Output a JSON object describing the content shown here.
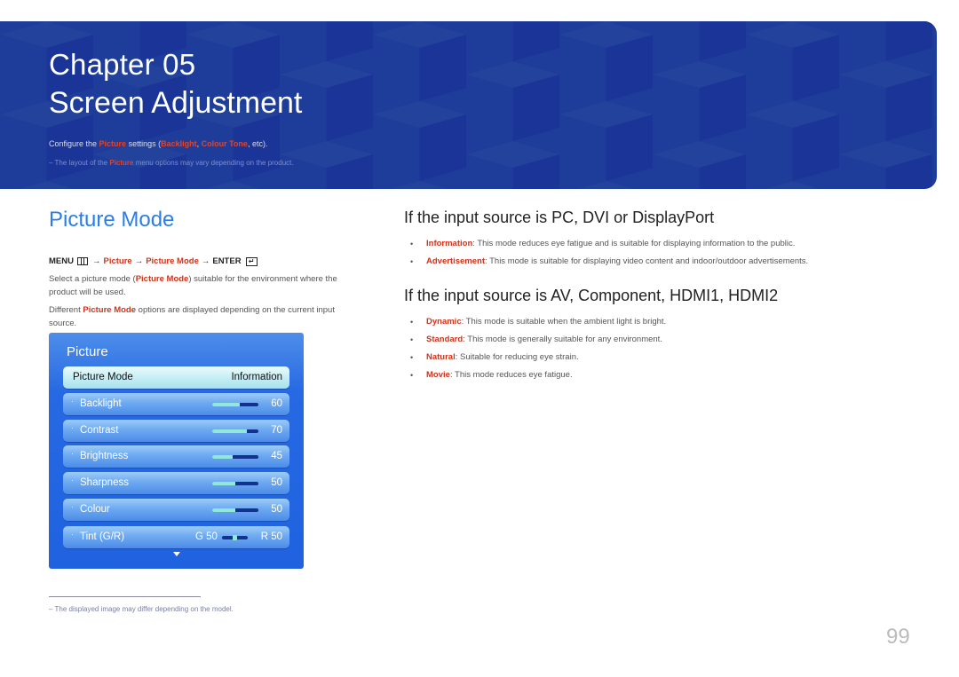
{
  "banner": {
    "chapter": "Chapter 05",
    "title": "Screen Adjustment",
    "desc": {
      "prefix": "Configure the ",
      "picture": "Picture",
      "mid": " settings (",
      "backlight": "Backlight",
      "comma": ", ",
      "colour_tone": "Colour Tone",
      "suffix": ", etc)."
    },
    "note": {
      "dash": "–",
      "prefix": " The layout of the ",
      "picture": "Picture",
      "suffix": " menu options may vary depending on the product."
    }
  },
  "section": {
    "title": "Picture Mode",
    "menu_path": {
      "menu": "MENU",
      "arrow": "→",
      "picture": "Picture",
      "picture_mode": "Picture Mode",
      "enter": "ENTER",
      "enter_glyph": "↵"
    },
    "para1": {
      "prefix": "Select a picture mode (",
      "highlight": "Picture Mode",
      "suffix": ") suitable for the environment where the product will be used."
    },
    "para2": {
      "prefix": "Different ",
      "highlight": "Picture Mode",
      "suffix": " options are displayed depending on the current input source."
    }
  },
  "osd": {
    "title": "Picture",
    "selected": {
      "label": "Picture Mode",
      "value": "Information"
    },
    "bullet": "·",
    "settings": [
      {
        "label": "Backlight",
        "value": "60",
        "level": 0.6
      },
      {
        "label": "Contrast",
        "value": "70",
        "level": 0.75
      },
      {
        "label": "Brightness",
        "value": "45",
        "level": 0.45
      },
      {
        "label": "Sharpness",
        "value": "50",
        "level": 0.5
      },
      {
        "label": "Colour",
        "value": "50",
        "level": 0.5
      }
    ],
    "tint": {
      "label": "Tint (G/R)",
      "g": "G 50",
      "r": "R 50",
      "level": 0.5
    },
    "more_arrow": "scroll-down-arrow"
  },
  "footnote": {
    "dash": "–",
    "text": " The displayed image may differ depending on the model."
  },
  "pc_source": {
    "heading": "If the input source is PC, DVI or DisplayPort",
    "items": [
      {
        "term": "Information",
        "desc": ": This mode reduces eye fatigue and is suitable for displaying information to the public."
      },
      {
        "term": "Advertisement",
        "desc": ": This mode is suitable for displaying video content and indoor/outdoor advertisements."
      }
    ]
  },
  "av_source": {
    "heading": "If the input source is AV, Component, HDMI1, HDMI2",
    "items": [
      {
        "term": "Dynamic",
        "desc": ": This mode is suitable when the ambient light is bright."
      },
      {
        "term": "Standard",
        "desc": ": This mode is generally suitable for any environment."
      },
      {
        "term": "Natural",
        "desc": ": Suitable for reducing eye strain."
      },
      {
        "term": "Movie",
        "desc": ": This mode reduces eye fatigue."
      }
    ]
  },
  "colors": {
    "banner": "#1e3c9a",
    "accent_blue": "#2a7ee6",
    "highlight_red": "#d0331b",
    "osd_panel": "#1f62e0"
  },
  "page_number": "99"
}
